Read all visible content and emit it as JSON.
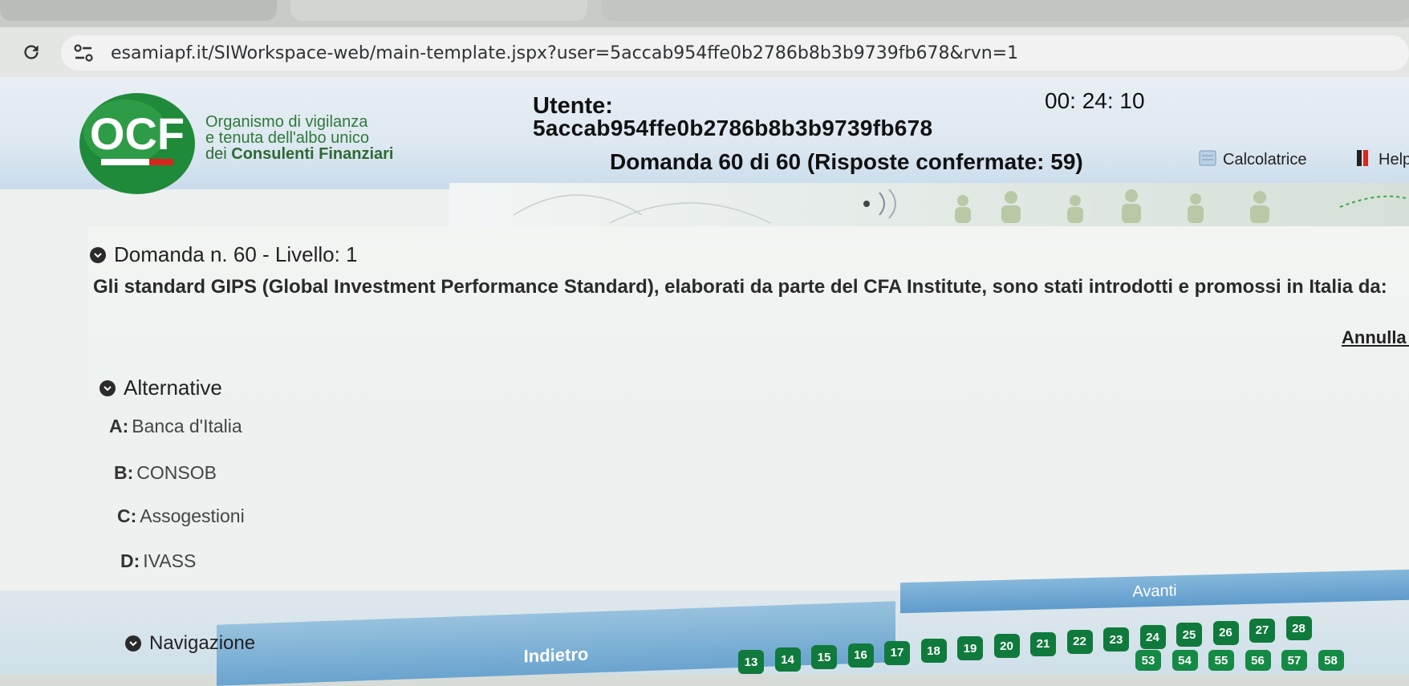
{
  "browser": {
    "url": "esamiapf.it/SIWorkspace-web/main-template.jspx?user=5accab954ffe0b2786b8b3b9739fb678&rvn=1"
  },
  "header": {
    "logo_text": "OCF",
    "org_line1": "Organismo di vigilanza",
    "org_line2": "e tenuta dell'albo unico",
    "org_line3_prefix": "dei ",
    "org_line3_bold": "Consulenti Finanziari",
    "user_label": "Utente:",
    "user_id": "5accab954ffe0b2786b8b3b9739fb678",
    "timer": "00: 24: 10",
    "question_counter": "Domanda 60 di 60 (Risposte confermate: 59)",
    "calculator_label": "Calcolatrice",
    "help_label": "Help"
  },
  "question": {
    "title": "Domanda n. 60 - Livello: 1",
    "text": "Gli standard GIPS (Global Investment Performance Standard), elaborati da parte del CFA Institute, sono stati introdotti e promossi in Italia da:",
    "cancel_label": "Annulla r"
  },
  "alternatives": {
    "title": "Alternative",
    "options": [
      {
        "key": "A:",
        "text": "Banca d'Italia"
      },
      {
        "key": "B:",
        "text": "CONSOB"
      },
      {
        "key": "C:",
        "text": "Assogestioni"
      },
      {
        "key": "D:",
        "text": "IVASS"
      }
    ]
  },
  "navigation": {
    "title": "Navigazione",
    "back_label": "Indietro",
    "next_label": "Avanti",
    "row1": [
      "13",
      "14",
      "15",
      "16",
      "17",
      "18",
      "19",
      "20",
      "21",
      "22",
      "23",
      "24",
      "25",
      "26",
      "27",
      "28"
    ],
    "row2": [
      "53",
      "54",
      "55",
      "56",
      "57",
      "58"
    ]
  },
  "colors": {
    "ocf_green": "#1f8a3a",
    "nav_green": "#0f7a3c",
    "button_blue": "#6aa4cf"
  }
}
